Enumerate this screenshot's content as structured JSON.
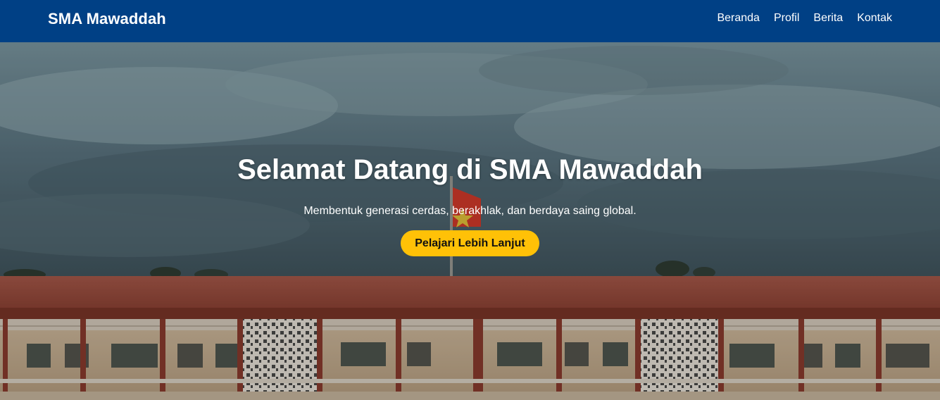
{
  "navbar": {
    "brand": "SMA Mawaddah",
    "links": [
      {
        "label": "Beranda"
      },
      {
        "label": "Profil"
      },
      {
        "label": "Berita"
      },
      {
        "label": "Kontak"
      }
    ],
    "background": "#004085"
  },
  "hero": {
    "title": "Selamat Datang di SMA Mawaddah",
    "subtitle": "Membentuk generasi cerdas, berakhlak, dan berdaya saing global.",
    "cta_label": "Pelajari Lebih Lanjut",
    "cta_color": "#ffc107"
  }
}
